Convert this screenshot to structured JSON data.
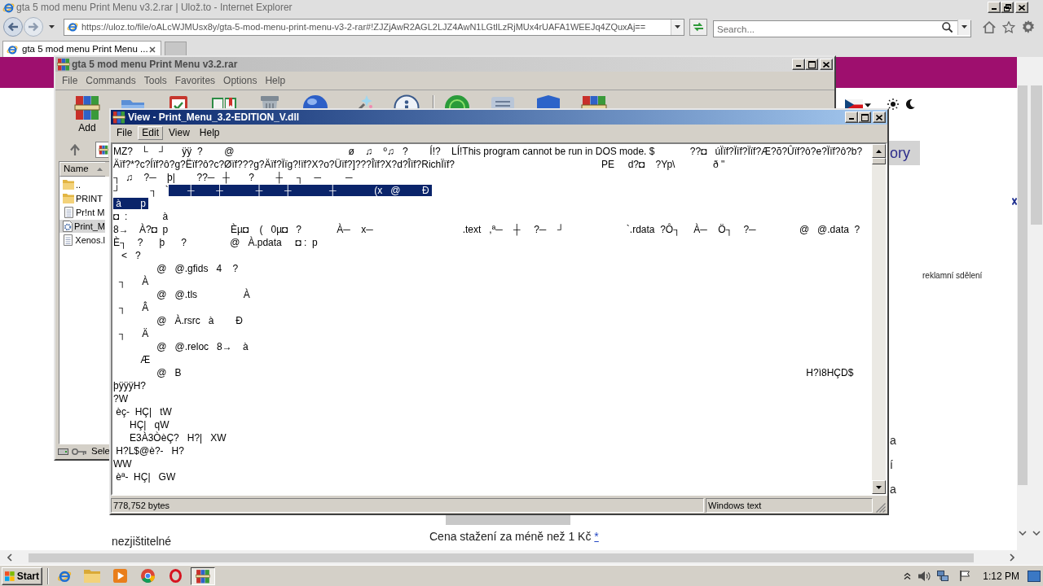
{
  "browser": {
    "title": "gta 5 mod menu Print Menu v3.2.rar | Ulož.to - Internet Explorer",
    "address": "https://uloz.to/file/oALcWJMUsx8y/gta-5-mod-menu-print-menu-v3-2-rar#!ZJZjAwR2AGL2LJZ4AwN1LGtlLzRjMUx4rUAFA1WEEJq4ZQuxAj==",
    "search": {
      "placeholder": "Search..."
    },
    "tabs": [
      {
        "label": "gta 5 mod menu Print Menu ...",
        "selected": true
      }
    ]
  },
  "page": {
    "category_button": "ory",
    "ad_label": "reklamní sdělení",
    "fragments": [
      "a",
      "í",
      "a"
    ],
    "footer_left": "nezjištitelné",
    "price_note": {
      "text": "Cena stažení za méně než 1 Kč",
      "link": "*"
    }
  },
  "archiver": {
    "title": "gta 5 mod menu Print Menu v3.2.rar",
    "menu": [
      "File",
      "Commands",
      "Tools",
      "Favorites",
      "Options",
      "Help"
    ],
    "toolbar": [
      {
        "label": "Add"
      }
    ],
    "columns": [
      "Name"
    ],
    "files": [
      {
        "name": "..",
        "kind": "folder",
        "selected": false
      },
      {
        "name": "PRINT",
        "kind": "folder",
        "selected": false
      },
      {
        "name": "Pr!nt M",
        "kind": "file",
        "selected": false
      },
      {
        "name": "Print_M",
        "kind": "dll",
        "selected": true
      },
      {
        "name": "Xenos.l",
        "kind": "file",
        "selected": false
      }
    ],
    "status": "Sele"
  },
  "viewer": {
    "title": "View - Print_Menu_3.2-EDITION_V.dll",
    "menu": [
      {
        "label": "File",
        "selected": false
      },
      {
        "label": "Edit",
        "selected": true
      },
      {
        "label": "View",
        "selected": false
      },
      {
        "label": "Help",
        "selected": false
      }
    ],
    "lines": [
      [
        {
          "text": "MZ?   └    ┘      ÿÿ  ?        @                                          ø    ♫    º♫   ?        Í!?    LÍ!This program cannot be run in DOS mode. $             ??◘   úÏïf?Ïïf?Ïïf?Æ?õ?Ûïf?ô?e?Ïïf?ô?b?",
          "selected": false
        }
      ],
      [
        {
          "text": "Äïf?*?c?Íïf?ô?g?Ëïf?ô?c?Øïf???g?Äïf?Ïïg?!ïf?X?o?Üïf?]???Îïf?X?d?Îïf?RichÏïf?                                                      PE     d?◘    ?Yp\\              ð \"",
          "selected": false
        }
      ],
      [
        {
          "text": "┐  ♫    ?─    þ|        ??─   ┼       ?        ┼     ┐    ─         ─",
          "selected": false
        }
      ],
      [
        {
          "text": "┘           ┐   `",
          "selected": false
        },
        {
          "text": "       ┼        ┼            ┼        ┼              ┼              (x   @        Ð ",
          "selected": true
        }
      ],
      [
        {
          "text": " à       p ",
          "selected": true
        }
      ],
      [
        {
          "text": "◘  :             à",
          "selected": false
        }
      ],
      [
        {
          "text": "8→    À?◘  p                       Èµ◘    (   0µ◘   ?             À─    x─                                 .text   ,ª─    ┼     ?─    ┘                       `.rdata  ?Ô┐     À─    Ö┐    ?─                @   @.data  ?",
          "selected": false
        }
      ],
      [
        {
          "text": "È┐    ?      þ      ?                @   À.pdata     ◘ :  p",
          "selected": false
        }
      ],
      [
        {
          "text": "   <   ?",
          "selected": false
        }
      ],
      [
        {
          "text": "                @   @.gfids   4    ?",
          "selected": false
        }
      ],
      [
        {
          "text": "  ┐      À",
          "selected": false
        }
      ],
      [
        {
          "text": "                @   @.tls                 À",
          "selected": false
        }
      ],
      [
        {
          "text": "  ┐      Â",
          "selected": false
        }
      ],
      [
        {
          "text": "                @   À.rsrc   à        Ð",
          "selected": false
        }
      ],
      [
        {
          "text": "  ┐      Ä",
          "selected": false
        }
      ],
      [
        {
          "text": "                @   @.reloc   8→    à",
          "selected": false
        }
      ],
      [
        {
          "text": "          Æ",
          "selected": false
        }
      ],
      [
        {
          "text": "                @   B                                                                                                                                                                                                                                      H?ì8HÇD$",
          "selected": false
        }
      ],
      [
        {
          "text": "þÿÿÿH?",
          "selected": false
        }
      ],
      [
        {
          "text": "?W",
          "selected": false
        }
      ],
      [
        {
          "text": " èç-  HÇ|   tW",
          "selected": false
        }
      ],
      [
        {
          "text": "      HÇ|   qW",
          "selected": false
        }
      ],
      [
        {
          "text": "      E3À3ÒèÇ?   H?|   XW",
          "selected": false
        }
      ],
      [
        {
          "text": " H?L$@è?-   H?",
          "selected": false
        }
      ],
      [
        {
          "text": "WW",
          "selected": false
        }
      ],
      [
        {
          "text": " èª-  HÇ|   GW",
          "selected": false
        }
      ]
    ],
    "size": "778,752 bytes",
    "encoding": "Windows text"
  },
  "taskbar": {
    "start": "Start",
    "apps": [
      {
        "kind": "ie",
        "selected": false
      },
      {
        "kind": "folder",
        "selected": false
      },
      {
        "kind": "media",
        "selected": false
      },
      {
        "kind": "chrome",
        "selected": false
      },
      {
        "kind": "opera",
        "selected": false
      },
      {
        "kind": "archiver",
        "selected": true
      }
    ],
    "clock": "1:12 PM"
  }
}
